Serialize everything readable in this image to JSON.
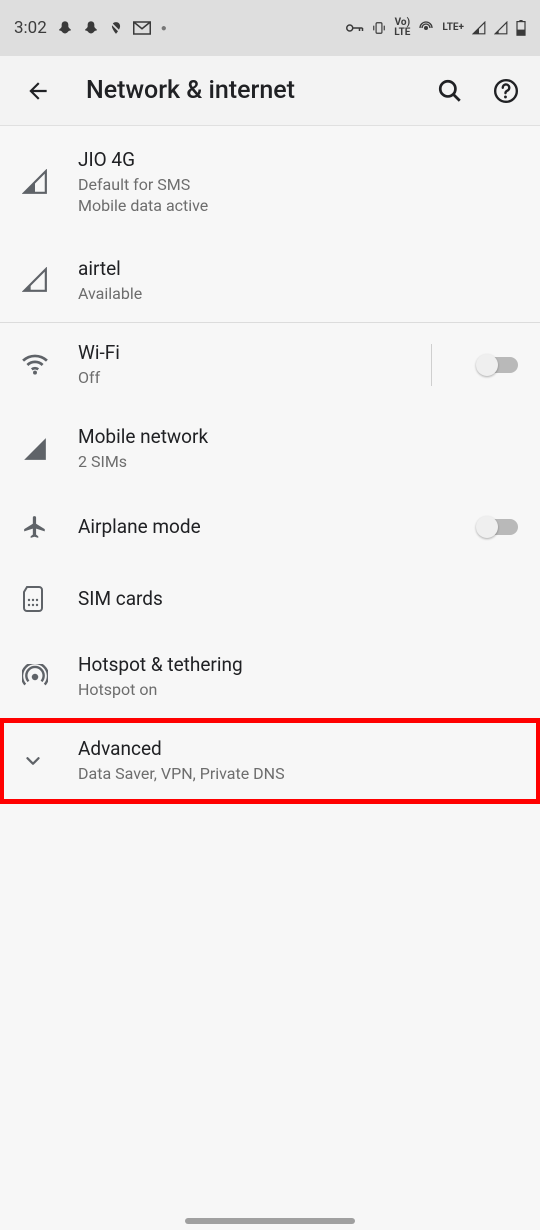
{
  "status": {
    "time": "3:02",
    "lte_badge": "LTE+"
  },
  "appbar": {
    "title": "Network & internet"
  },
  "sim1": {
    "title": "JIO 4G",
    "sub1": "Default for SMS",
    "sub2": "Mobile data active"
  },
  "sim2": {
    "title": "airtel",
    "sub": "Available"
  },
  "wifi": {
    "title": "Wi-Fi",
    "sub": "Off"
  },
  "mobile": {
    "title": "Mobile network",
    "sub": "2 SIMs"
  },
  "airplane": {
    "title": "Airplane mode"
  },
  "simcards": {
    "title": "SIM cards"
  },
  "hotspot": {
    "title": "Hotspot & tethering",
    "sub": "Hotspot on"
  },
  "advanced": {
    "title": "Advanced",
    "sub": "Data Saver, VPN, Private DNS"
  }
}
